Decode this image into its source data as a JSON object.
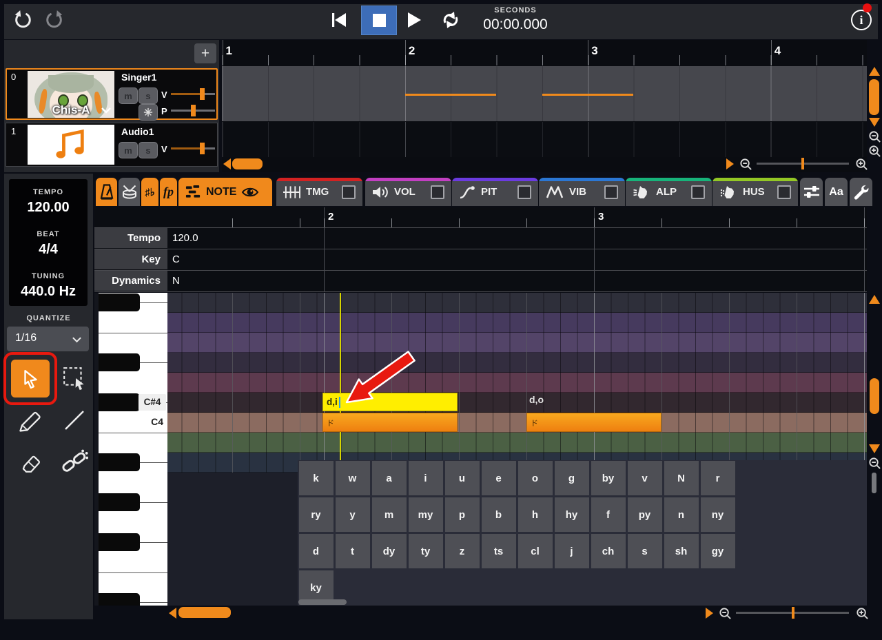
{
  "topbar": {
    "seconds_label": "SECONDS",
    "time": "00:00.000"
  },
  "track_panel": {
    "add_label": "+",
    "tracks": [
      {
        "index": "0",
        "title": "Singer1",
        "voice": "Chis-A",
        "mute": "m",
        "solo": "s",
        "volume_label": "V",
        "pitch_label": "P"
      },
      {
        "index": "1",
        "title": "Audio1",
        "mute": "m",
        "solo": "s",
        "volume_label": "V"
      }
    ]
  },
  "timeline": {
    "measures": [
      "1",
      "2",
      "3",
      "4"
    ]
  },
  "sidebar": {
    "tempo_label": "TEMPO",
    "tempo_value": "120.00",
    "beat_label": "BEAT",
    "beat_value": "4/4",
    "tuning_label": "TUNING",
    "tuning_value": "440.0 Hz",
    "quantize_label": "QUANTIZE",
    "quantize_value": "1/16"
  },
  "tabs": {
    "note": {
      "label": "NOTE"
    },
    "key_tab_glyphs": "♯♭",
    "dyn_tab_glyphs": "fp",
    "aa_label": "Aa",
    "params": [
      {
        "id": "tmg",
        "label": "TMG",
        "stripe": "#D32222"
      },
      {
        "id": "vol",
        "label": "VOL",
        "stripe": "#C23FC2"
      },
      {
        "id": "pit",
        "label": "PIT",
        "stripe": "#6B3BE0"
      },
      {
        "id": "vib",
        "label": "VIB",
        "stripe": "#2B77D4"
      },
      {
        "id": "alp",
        "label": "ALP",
        "stripe": "#17B37A"
      },
      {
        "id": "hus",
        "label": "HUS",
        "stripe": "#93C725"
      }
    ]
  },
  "params_panel": {
    "ruler_labels": [
      "2",
      "3"
    ],
    "rows": [
      {
        "label": "Tempo",
        "value": "120.0"
      },
      {
        "label": "Key",
        "value": "C"
      },
      {
        "label": "Dynamics",
        "value": "N"
      }
    ]
  },
  "piano_roll": {
    "ruler_labels": [
      "2",
      "3"
    ],
    "key_labels": [
      {
        "text": "C#4"
      },
      {
        "text": "C4"
      }
    ],
    "notes": [
      {
        "lyric": "ド",
        "phoneme": "d,i",
        "state": "editing"
      },
      {
        "lyric": "ド",
        "phoneme": "d,o",
        "state": "normal"
      }
    ],
    "rows": [
      {
        "note": "F#4",
        "sharp": true,
        "color": "#2E2F3A"
      },
      {
        "note": "F4",
        "sharp": false,
        "color": "#463A5E"
      },
      {
        "note": "E4",
        "sharp": false,
        "color": "#534468"
      },
      {
        "note": "D#4",
        "sharp": true,
        "color": "#332D3F"
      },
      {
        "note": "D4",
        "sharp": false,
        "color": "#5D3A4E"
      },
      {
        "note": "C#4",
        "sharp": true,
        "color": "#32282F"
      },
      {
        "note": "C4",
        "sharp": false,
        "color": "#8B6B60"
      },
      {
        "note": "B3",
        "sharp": false,
        "color": "#4B6044"
      },
      {
        "note": "A#3",
        "sharp": true,
        "color": "#293241"
      },
      {
        "note": "A3",
        "sharp": false,
        "color": null
      },
      {
        "note": "G#3",
        "sharp": true,
        "color": null
      },
      {
        "note": "G3",
        "sharp": false,
        "color": null
      },
      {
        "note": "F#3",
        "sharp": true,
        "color": null
      },
      {
        "note": "F3",
        "sharp": false,
        "color": null
      },
      {
        "note": "E3",
        "sharp": false,
        "color": null
      },
      {
        "note": "D#3",
        "sharp": true,
        "color": null
      }
    ]
  },
  "phoneme_keyboard": {
    "rows": [
      [
        "k",
        "w",
        "a",
        "i",
        "u",
        "e",
        "o",
        "g",
        "by",
        "v",
        "N",
        "r"
      ],
      [
        "ry",
        "y",
        "m",
        "my",
        "p",
        "b",
        "h",
        "hy",
        "f",
        "py",
        "n",
        "ny"
      ],
      [
        "d",
        "t",
        "dy",
        "ty",
        "z",
        "ts",
        "cl",
        "j",
        "ch",
        "s",
        "sh",
        "gy"
      ],
      [
        "ky"
      ]
    ]
  },
  "colors": {
    "accent_orange": "#F0891C",
    "transport_active_blue": "#3D6DB8",
    "annotation_red": "#E8190F",
    "selected_note_yellow": "#FFEE00",
    "playhead_yellow": "#D6D400"
  }
}
